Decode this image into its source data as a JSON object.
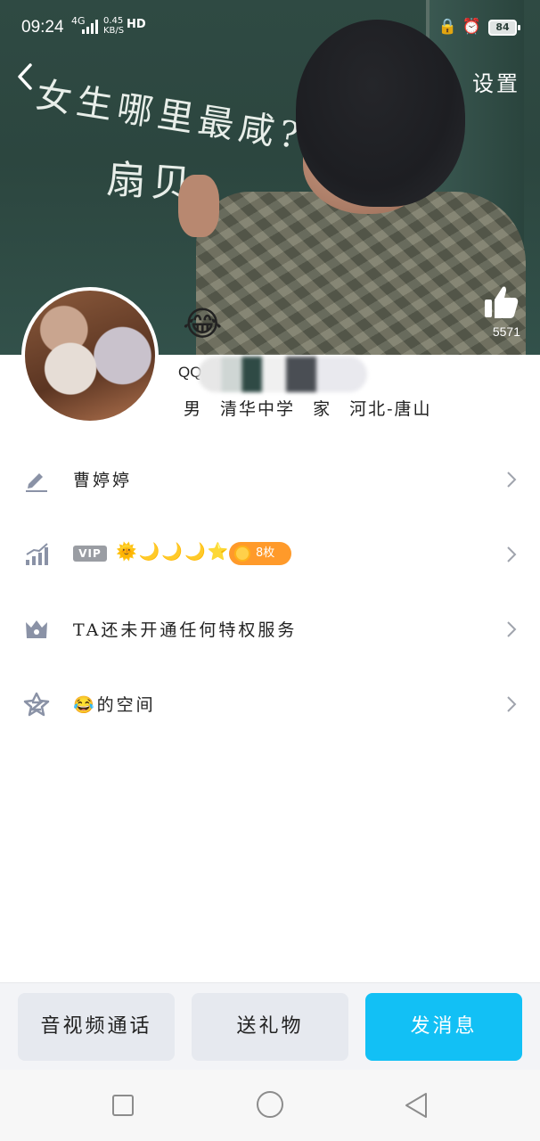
{
  "status_bar": {
    "time": "09:24",
    "signal_type": "4G",
    "speed_value": "0.45",
    "speed_unit": "KB/S",
    "hd": "HD",
    "battery": "84"
  },
  "header": {
    "settings_label": "设置",
    "chalk_question": "女生哪里最咸?",
    "chalk_answer": "扇贝",
    "like_count": "5571"
  },
  "profile": {
    "emoji": "😂",
    "qq_prefix": "QQ",
    "info": "男 清华中学 家 河北-唐山"
  },
  "list": {
    "nickname": "曹婷婷",
    "vip_label": "VIP",
    "vip_level_icons": "🌞🌙🌙🌙⭐",
    "medal_count": "8枚",
    "privilege_text": "TA还未开通任何特权服务",
    "space_emoji": "😂",
    "space_suffix": "的空间"
  },
  "actions": {
    "call": "音视频通话",
    "gift": "送礼物",
    "message": "发消息"
  },
  "colors": {
    "accent": "#12c0f5",
    "medal": "#ff9a2a",
    "icon_gray": "#8a92a6"
  }
}
